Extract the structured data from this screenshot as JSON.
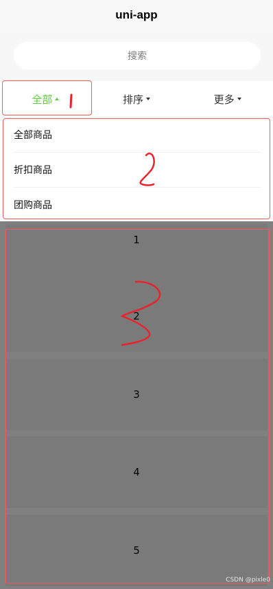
{
  "nav": {
    "title": "uni-app"
  },
  "search": {
    "placeholder": "搜索"
  },
  "tabs": [
    {
      "label": "全部",
      "active": true
    },
    {
      "label": "排序",
      "active": false
    },
    {
      "label": "更多",
      "active": false
    }
  ],
  "dropdown": {
    "items": [
      "全部商品",
      "折扣商品",
      "团购商品"
    ]
  },
  "list": {
    "items": [
      "1",
      "2",
      "3",
      "4",
      "5"
    ]
  },
  "annotations": {
    "mark_1": "1",
    "mark_2": "2",
    "mark_3": "3"
  },
  "watermark": "CSDN @pixle0",
  "colors": {
    "active_tab": "#5ccc3c",
    "annotation": "#f05a5a",
    "scribble": "#e8232b",
    "mask": "#808080"
  }
}
